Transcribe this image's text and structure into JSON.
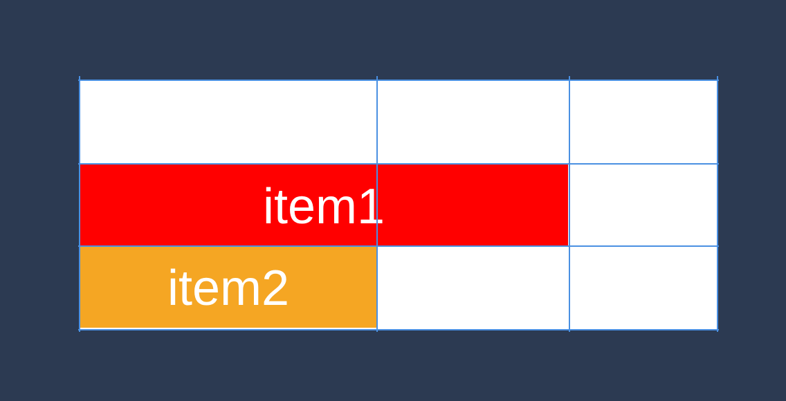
{
  "diagram": {
    "items": [
      {
        "label": "item1",
        "color": "#ff0000"
      },
      {
        "label": "item2",
        "color": "#f5a623"
      }
    ],
    "grid_line_color": "#4a90e2",
    "background_color": "#2c3a52",
    "cell_background": "#ffffff"
  }
}
